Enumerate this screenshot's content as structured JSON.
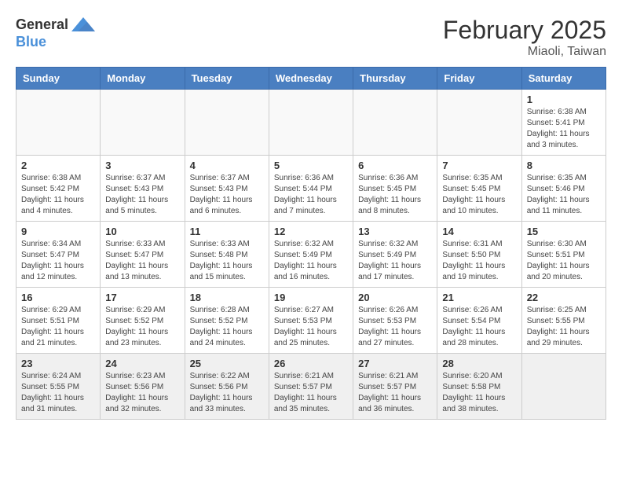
{
  "logo": {
    "text_general": "General",
    "text_blue": "Blue"
  },
  "header": {
    "month": "February 2025",
    "location": "Miaoli, Taiwan"
  },
  "weekdays": [
    "Sunday",
    "Monday",
    "Tuesday",
    "Wednesday",
    "Thursday",
    "Friday",
    "Saturday"
  ],
  "weeks": [
    [
      {
        "day": "",
        "info": ""
      },
      {
        "day": "",
        "info": ""
      },
      {
        "day": "",
        "info": ""
      },
      {
        "day": "",
        "info": ""
      },
      {
        "day": "",
        "info": ""
      },
      {
        "day": "",
        "info": ""
      },
      {
        "day": "1",
        "info": "Sunrise: 6:38 AM\nSunset: 5:41 PM\nDaylight: 11 hours\nand 3 minutes."
      }
    ],
    [
      {
        "day": "2",
        "info": "Sunrise: 6:38 AM\nSunset: 5:42 PM\nDaylight: 11 hours\nand 4 minutes."
      },
      {
        "day": "3",
        "info": "Sunrise: 6:37 AM\nSunset: 5:43 PM\nDaylight: 11 hours\nand 5 minutes."
      },
      {
        "day": "4",
        "info": "Sunrise: 6:37 AM\nSunset: 5:43 PM\nDaylight: 11 hours\nand 6 minutes."
      },
      {
        "day": "5",
        "info": "Sunrise: 6:36 AM\nSunset: 5:44 PM\nDaylight: 11 hours\nand 7 minutes."
      },
      {
        "day": "6",
        "info": "Sunrise: 6:36 AM\nSunset: 5:45 PM\nDaylight: 11 hours\nand 8 minutes."
      },
      {
        "day": "7",
        "info": "Sunrise: 6:35 AM\nSunset: 5:45 PM\nDaylight: 11 hours\nand 10 minutes."
      },
      {
        "day": "8",
        "info": "Sunrise: 6:35 AM\nSunset: 5:46 PM\nDaylight: 11 hours\nand 11 minutes."
      }
    ],
    [
      {
        "day": "9",
        "info": "Sunrise: 6:34 AM\nSunset: 5:47 PM\nDaylight: 11 hours\nand 12 minutes."
      },
      {
        "day": "10",
        "info": "Sunrise: 6:33 AM\nSunset: 5:47 PM\nDaylight: 11 hours\nand 13 minutes."
      },
      {
        "day": "11",
        "info": "Sunrise: 6:33 AM\nSunset: 5:48 PM\nDaylight: 11 hours\nand 15 minutes."
      },
      {
        "day": "12",
        "info": "Sunrise: 6:32 AM\nSunset: 5:49 PM\nDaylight: 11 hours\nand 16 minutes."
      },
      {
        "day": "13",
        "info": "Sunrise: 6:32 AM\nSunset: 5:49 PM\nDaylight: 11 hours\nand 17 minutes."
      },
      {
        "day": "14",
        "info": "Sunrise: 6:31 AM\nSunset: 5:50 PM\nDaylight: 11 hours\nand 19 minutes."
      },
      {
        "day": "15",
        "info": "Sunrise: 6:30 AM\nSunset: 5:51 PM\nDaylight: 11 hours\nand 20 minutes."
      }
    ],
    [
      {
        "day": "16",
        "info": "Sunrise: 6:29 AM\nSunset: 5:51 PM\nDaylight: 11 hours\nand 21 minutes."
      },
      {
        "day": "17",
        "info": "Sunrise: 6:29 AM\nSunset: 5:52 PM\nDaylight: 11 hours\nand 23 minutes."
      },
      {
        "day": "18",
        "info": "Sunrise: 6:28 AM\nSunset: 5:52 PM\nDaylight: 11 hours\nand 24 minutes."
      },
      {
        "day": "19",
        "info": "Sunrise: 6:27 AM\nSunset: 5:53 PM\nDaylight: 11 hours\nand 25 minutes."
      },
      {
        "day": "20",
        "info": "Sunrise: 6:26 AM\nSunset: 5:53 PM\nDaylight: 11 hours\nand 27 minutes."
      },
      {
        "day": "21",
        "info": "Sunrise: 6:26 AM\nSunset: 5:54 PM\nDaylight: 11 hours\nand 28 minutes."
      },
      {
        "day": "22",
        "info": "Sunrise: 6:25 AM\nSunset: 5:55 PM\nDaylight: 11 hours\nand 29 minutes."
      }
    ],
    [
      {
        "day": "23",
        "info": "Sunrise: 6:24 AM\nSunset: 5:55 PM\nDaylight: 11 hours\nand 31 minutes."
      },
      {
        "day": "24",
        "info": "Sunrise: 6:23 AM\nSunset: 5:56 PM\nDaylight: 11 hours\nand 32 minutes."
      },
      {
        "day": "25",
        "info": "Sunrise: 6:22 AM\nSunset: 5:56 PM\nDaylight: 11 hours\nand 33 minutes."
      },
      {
        "day": "26",
        "info": "Sunrise: 6:21 AM\nSunset: 5:57 PM\nDaylight: 11 hours\nand 35 minutes."
      },
      {
        "day": "27",
        "info": "Sunrise: 6:21 AM\nSunset: 5:57 PM\nDaylight: 11 hours\nand 36 minutes."
      },
      {
        "day": "28",
        "info": "Sunrise: 6:20 AM\nSunset: 5:58 PM\nDaylight: 11 hours\nand 38 minutes."
      },
      {
        "day": "",
        "info": ""
      }
    ]
  ]
}
